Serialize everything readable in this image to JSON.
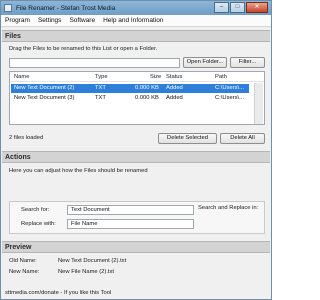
{
  "window": {
    "title": "File Renamer - Stefan Trost Media",
    "controls": [
      "–",
      "□",
      "✕"
    ]
  },
  "menu": [
    "Program",
    "Settings",
    "Software",
    "Help and Information"
  ],
  "files": {
    "heading": "Files",
    "instruction": "Drag the Files to be renamed to this List or open a Folder.",
    "path_value": "",
    "open_folder_label": "Open Folder...",
    "filter_label": "Filter...",
    "columns": [
      "Name",
      "Type",
      "Size",
      "Status",
      "Path"
    ],
    "rows": [
      {
        "name": "New Text Document (2)",
        "type": "TXT",
        "size": "0.000 KB",
        "status": "Added",
        "path": "C:\\Users\\...",
        "selected": true
      },
      {
        "name": "New Text Document (3)",
        "type": "TXT",
        "size": "0.000 KB",
        "status": "Added",
        "path": "C:\\Users\\...",
        "selected": false
      }
    ],
    "loaded_text": "2 files loaded",
    "delete_selected_label": "Delete Selected",
    "delete_all_label": "Delete All"
  },
  "actions": {
    "heading": "Actions",
    "description": "Here you can adjust how the Files should be renamed",
    "search_label": "Search for:",
    "search_value": "Text Document",
    "replace_label": "Replace with:",
    "replace_value": "File Name",
    "search_replace_in": "Search and Replace in:"
  },
  "preview": {
    "heading": "Preview",
    "old_label": "Old Name:",
    "old_value": "New Text Document (2).txt",
    "new_label": "New Name:",
    "new_value": "New File Name (2).txt"
  },
  "status_text": "sttmedia.com/donate - If you like this Tool"
}
